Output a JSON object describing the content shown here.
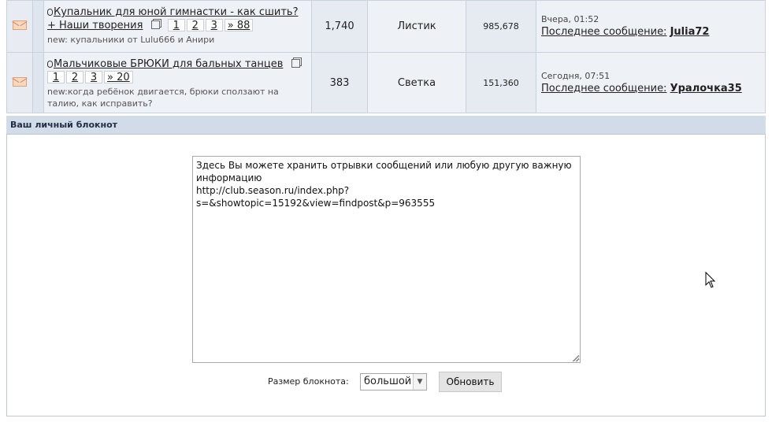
{
  "topics": [
    {
      "title": "Купальник для юной гимнастки - как сшить? + Наши творения",
      "pages": [
        "1",
        "2",
        "3",
        "» 88"
      ],
      "new_text": "new: купальники от Lulu666 и Анири",
      "replies": "1,740",
      "author": "Листик",
      "views": "985,678",
      "last_date": "Вчера, 01:52",
      "last_prefix": "Последнее сообщение:",
      "last_user": "Julia72"
    },
    {
      "title": "Мальчиковые БРЮКИ для бальных танцев",
      "pages": [
        "1",
        "2",
        "3",
        "» 20"
      ],
      "new_text": "new:когда ребёнок двигается, брюки сползают на талию, как исправить?",
      "replies": "383",
      "author": "Светка",
      "views": "151,360",
      "last_date": "Сегодня, 07:51",
      "last_prefix": "Последнее сообщение:",
      "last_user": "Уралочка35"
    }
  ],
  "notepad": {
    "header": "Ваш личный блокнот",
    "content": "Здесь Вы можете хранить отрывки сообщений или любую другую важную информацию\nhttp://club.season.ru/index.php?s=&showtopic=15192&view=findpost&p=963555",
    "size_label": "Размер блокнота:",
    "size_value": "большой",
    "update_button": "Обновить"
  }
}
